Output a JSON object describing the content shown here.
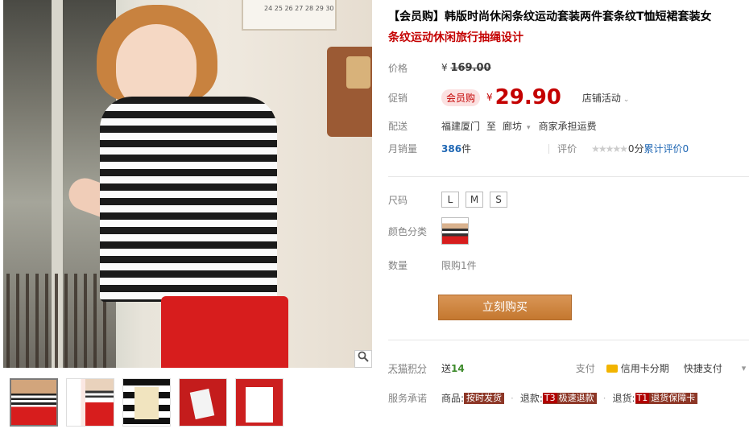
{
  "calendar": {
    "numbers": "24 25 26 27 28 29 30"
  },
  "product": {
    "title": "【会员购】韩版时尚休闲条纹运动套装两件套条纹T恤短裙套装女",
    "subtitle": "条纹运动休闲旅行抽绳设计"
  },
  "price": {
    "label": "价格",
    "currency": "¥",
    "original": "169.00"
  },
  "promo": {
    "label": "促销",
    "badge": "会员购",
    "currency": "¥",
    "price": "29.90",
    "shop_activity": "店铺活动",
    "arrow": "⌄"
  },
  "shipping": {
    "label": "配送",
    "from": "福建厦门",
    "to_word": "至",
    "to": "廊坊",
    "arrow": "▾",
    "fee": "商家承担运费"
  },
  "sales": {
    "label": "月销量",
    "count": "386",
    "unit": "件",
    "rating_label": "评价",
    "stars": "★★★★★",
    "score": "0分",
    "review_link": "累计评价0"
  },
  "size": {
    "label": "尺码",
    "options": [
      "L",
      "M",
      "S"
    ]
  },
  "color": {
    "label": "颜色分类"
  },
  "quantity": {
    "label": "数量",
    "limit": "限购1件"
  },
  "buy_button": "立刻购买",
  "points": {
    "label": "天猫积分",
    "prefix": "送",
    "value": "14"
  },
  "payment": {
    "label": "支付",
    "credit": "信用卡分期",
    "fast": "快捷支付",
    "arrow": "▾"
  },
  "service": {
    "label": "服务承诺",
    "goods_label": "商品:",
    "goods_tag": "按时发货",
    "refund_label": "退款:",
    "refund_code": "T3",
    "refund_tag": "极速退款",
    "return_label": "退货:",
    "return_code": "T1",
    "return_tag": "退货保障卡",
    "dot": "·"
  },
  "zoom_icon": "search-icon",
  "colors": {
    "price_red": "#c40000",
    "buy_button": "#c4782f",
    "link_blue": "#1f67b4"
  }
}
